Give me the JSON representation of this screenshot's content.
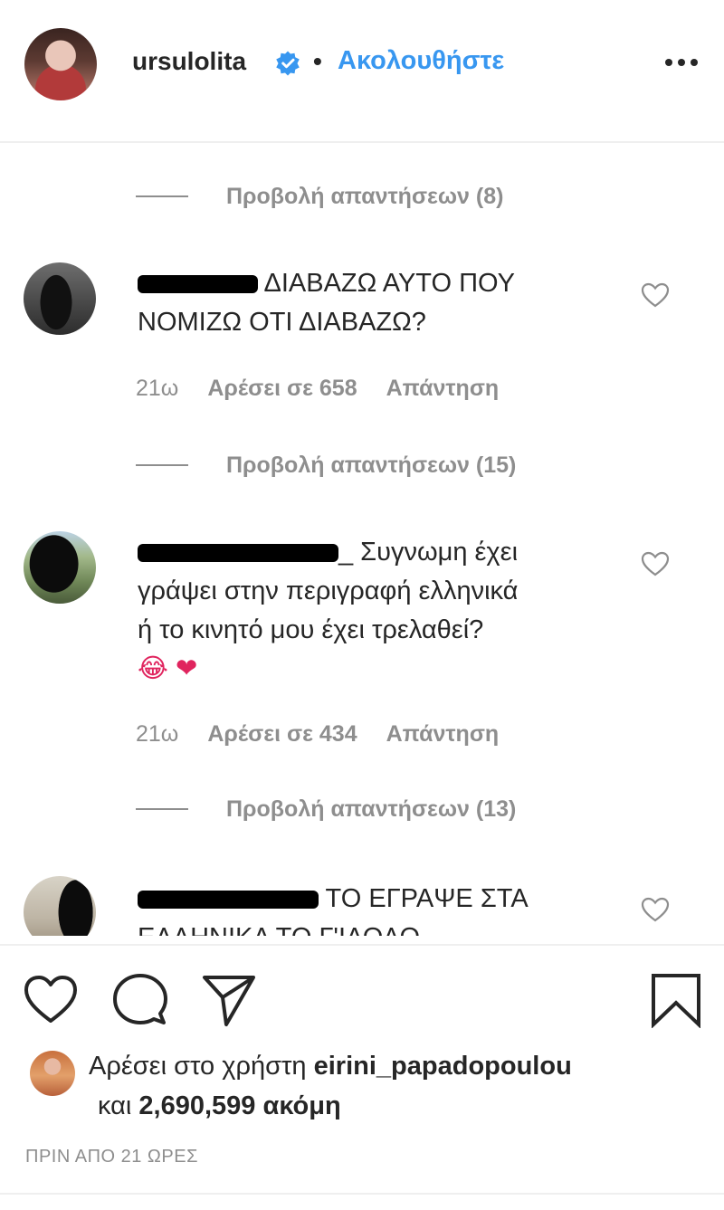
{
  "post": {
    "username": "ursulolita",
    "separator": "•",
    "follow_label": "Ακολουθήστε",
    "more_icon": "more-horizontal-icon",
    "verified_icon": "verified-badge-icon"
  },
  "comments": [
    {
      "view_replies_label": "Προβολή απαντήσεων (8)",
      "text_line1": "ΔΙΑΒΑΖΩ ΑΥΤΟ ΠΟΥ",
      "text_line2": "ΝΟΜΙΖΩ ΟΤΙ ΔΙΑΒΑΖΩ?",
      "time": "21ω",
      "likes": "Αρέσει σε 658",
      "reply_label": "Απάντηση"
    },
    {
      "view_replies_label": "Προβολή απαντήσεων (15)",
      "text_line1": "_ Συγνωμη έχει",
      "text_line2": "γράψει στην περιγραφή ελληνικά",
      "text_line3": "ή το κινητό μου έχει τρελαθεί?",
      "emoji": "😂 ❤",
      "time": "21ω",
      "likes": "Αρέσει σε 434",
      "reply_label": "Απάντηση"
    },
    {
      "view_replies_label": "Προβολή απαντήσεων (13)",
      "text_line1": "ΤΟ ΕΓΡΑΨΕ ΣΤΑ",
      "text_line2": "ΕΛΛΗΝΙΚΑ ΤΟ Γ'ΙΑΟΛΟ"
    }
  ],
  "actions": {
    "like_icon": "heart-icon",
    "comment_icon": "comment-icon",
    "share_icon": "share-icon",
    "save_icon": "bookmark-icon"
  },
  "liked_by": {
    "prefix": "Αρέσει στο χρήστη",
    "user": "eirini_papadopoulou",
    "and_label": "και",
    "count": "2,690,599",
    "suffix": "ακόμη"
  },
  "timestamp": "ΠΡΙΝ ΑΠΟ 21 ΩΡΕΣ",
  "colors": {
    "accent": "#3897f0",
    "text": "#262626",
    "muted": "#8e8e8e",
    "divider": "#efefef"
  }
}
